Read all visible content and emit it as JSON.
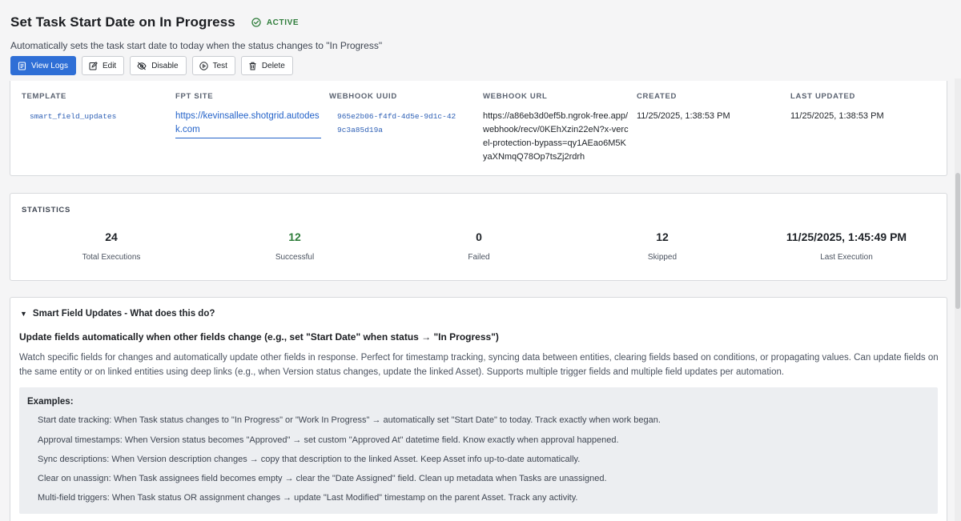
{
  "header": {
    "title": "Set Task Start Date on In Progress",
    "status": "ACTIVE",
    "description": "Automatically sets the task start date to today when the status changes to \"In Progress\""
  },
  "toolbar": {
    "view_logs": "View Logs",
    "edit": "Edit",
    "disable": "Disable",
    "test": "Test",
    "delete": "Delete"
  },
  "info": {
    "template_label": "TEMPLATE",
    "template_value": "smart_field_updates",
    "site_label": "FPT SITE",
    "site_value": "https://kevinsallee.shotgrid.autodesk.com",
    "uuid_label": "WEBHOOK UUID",
    "uuid_value": "965e2b06-f4fd-4d5e-9d1c-429c3a85d19a",
    "url_label": "WEBHOOK URL",
    "url_value": "https://a86eb3d0ef5b.ngrok-free.app/webhook/recv/0KEhXzin22eN?x-vercel-protection-bypass=qy1AEao6M5KyaXNmqQ78Op7tsZj2rdrh",
    "created_label": "CREATED",
    "created_value": "11/25/2025, 1:38:53 PM",
    "updated_label": "LAST UPDATED",
    "updated_value": "11/25/2025, 1:38:53 PM"
  },
  "stats": {
    "label": "STATISTICS",
    "items": [
      {
        "value": "24",
        "caption": "Total Executions"
      },
      {
        "value": "12",
        "caption": "Successful"
      },
      {
        "value": "0",
        "caption": "Failed"
      },
      {
        "value": "12",
        "caption": "Skipped"
      },
      {
        "value": "11/25/2025, 1:45:49 PM",
        "caption": "Last Execution"
      }
    ]
  },
  "help": {
    "summary": "Smart Field Updates - What does this do?",
    "heading": "Update fields automatically when other fields change (e.g., set \"Start Date\" when status → \"In Progress\")",
    "body": "Watch specific fields for changes and automatically update other fields in response. Perfect for timestamp tracking, syncing data between entities, clearing fields based on conditions, or propagating values. Can update fields on the same entity or on linked entities using deep links (e.g., when Version status changes, update the linked Asset). Supports multiple trigger fields and multiple field updates per automation.",
    "examples_title": "Examples:",
    "examples": [
      "Start date tracking: When Task status changes to \"In Progress\" or \"Work In Progress\" → automatically set \"Start Date\" to today. Track exactly when work began.",
      "Approval timestamps: When Version status becomes \"Approved\" → set custom \"Approved At\" datetime field. Know exactly when approval happened.",
      "Sync descriptions: When Version description changes → copy that description to the linked Asset. Keep Asset info up-to-date automatically.",
      "Clear on unassign: When Task assignees field becomes empty → clear the \"Date Assigned\" field. Clean up metadata when Tasks are unassigned.",
      "Multi-field triggers: When Task status OR assignment changes → update \"Last Modified\" timestamp on the parent Asset. Track any activity."
    ]
  },
  "colors": {
    "primary": "#2f6fd6",
    "success": "#2f7d3b",
    "link": "#2463c9"
  }
}
